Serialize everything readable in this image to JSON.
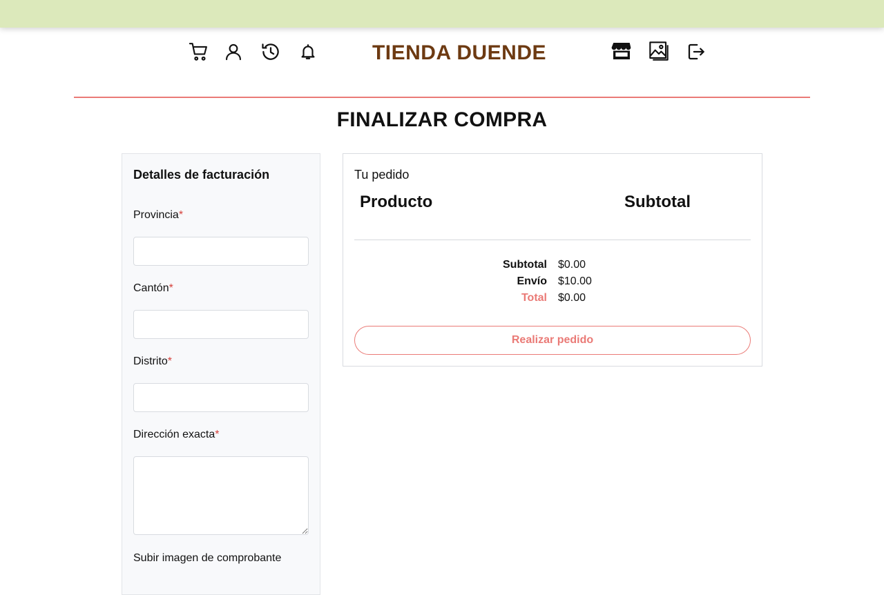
{
  "header": {
    "brand": "TIENDA DUENDE",
    "colors": {
      "topbar": "#dce9bb",
      "brand": "#6d3a12",
      "accent": "#ea7a76"
    },
    "left_icons": [
      "cart-icon",
      "user-icon",
      "history-icon",
      "bell-icon"
    ],
    "right_icons": [
      "store-icon",
      "gallery-icon",
      "logout-icon"
    ]
  },
  "page": {
    "title": "FINALIZAR COMPRA"
  },
  "billing": {
    "title": "Detalles de facturación",
    "required_mark": "*",
    "fields": [
      {
        "label": "Provincia",
        "value": ""
      },
      {
        "label": "Cantón",
        "value": ""
      },
      {
        "label": "Distrito",
        "value": ""
      },
      {
        "label": "Dirección exacta",
        "value": ""
      }
    ],
    "upload_label": "Subir imagen de comprobante"
  },
  "order": {
    "title": "Tu pedido",
    "columns": {
      "product": "Producto",
      "subtotal": "Subtotal"
    },
    "summary": {
      "subtotal_label": "Subtotal",
      "subtotal_value": "$0.00",
      "shipping_label": "Envío",
      "shipping_value": "$10.00",
      "total_label": "Total",
      "total_value": "$0.00"
    },
    "submit_label": "Realizar pedido"
  }
}
